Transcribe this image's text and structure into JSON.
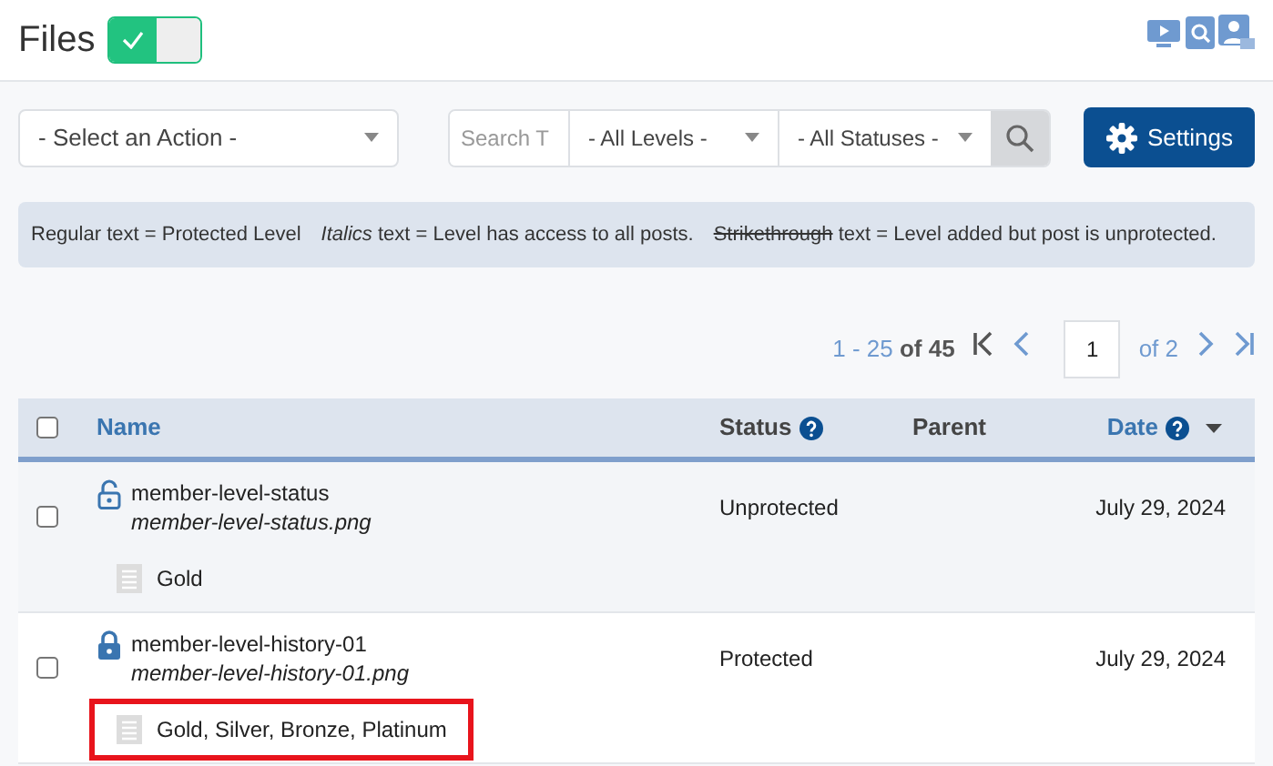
{
  "header": {
    "title": "Files",
    "toggle_on": true
  },
  "toolbar": {
    "action_select": "- Select an Action -",
    "search_placeholder": "Search T",
    "levels_select": "- All Levels -",
    "statuses_select": "- All Statuses -",
    "settings_button": "Settings"
  },
  "legend": [
    {
      "term": "Regular",
      "kind": "regular",
      "rest": "text = Protected Level"
    },
    {
      "term": "Italics",
      "kind": "italic",
      "rest": "text = Level has access to all posts."
    },
    {
      "term": "Strikethrough",
      "kind": "strike",
      "rest": "text = Level added but post is unprotected."
    }
  ],
  "pagination": {
    "range": "1 - 25",
    "total": "of 45",
    "page": "1",
    "pages": "of 2"
  },
  "table": {
    "select_all_checked": false,
    "columns": [
      {
        "label": "Name",
        "kind": "link",
        "help": false
      },
      {
        "label": "Status",
        "kind": "plain",
        "help": true
      },
      {
        "label": "Parent",
        "kind": "plain",
        "help": false
      },
      {
        "label": "Date",
        "kind": "link",
        "help": true,
        "sort": true
      }
    ],
    "rows": [
      {
        "name": "member-level-status",
        "file": "member-level-status.png",
        "status": "Unprotected",
        "date": "July 29, 2024",
        "locked": false,
        "hovered": true,
        "checked": false,
        "levels": "Gold",
        "outlined": false
      },
      {
        "name": "member-level-history-01",
        "file": "member-level-history-01.png",
        "status": "Protected",
        "date": "July 29, 2024",
        "locked": true,
        "hovered": false,
        "checked": false,
        "levels": "Gold, Silver, Bronze, Platinum",
        "outlined": true
      }
    ]
  }
}
